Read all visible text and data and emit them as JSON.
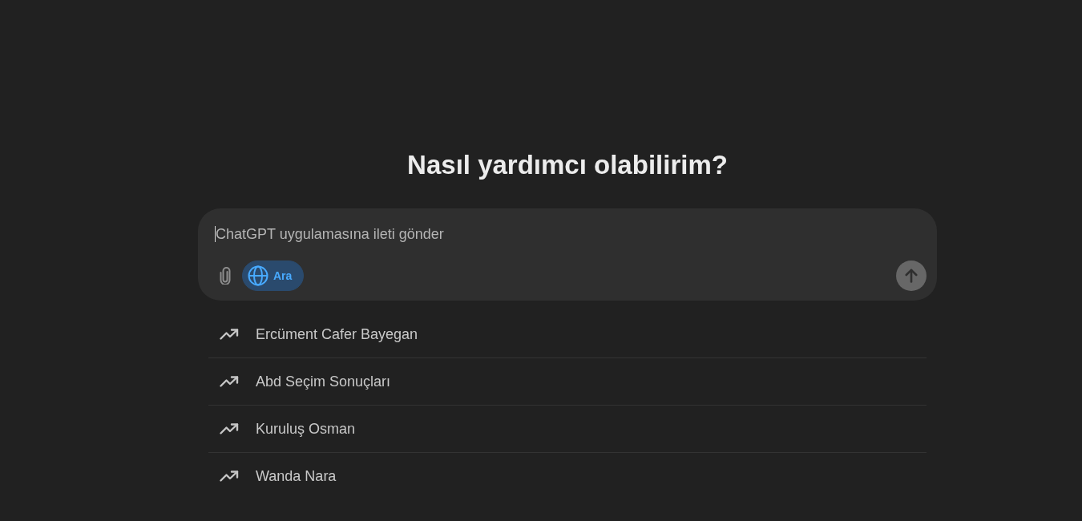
{
  "heading": "Nasıl yardımcı olabilirim?",
  "composer": {
    "placeholder": "ChatGPT uygulamasına ileti gönder",
    "focused": true,
    "search_toggle": {
      "label": "Ara",
      "selected": true
    },
    "send_button": {
      "disabled": true
    }
  },
  "suggestions": [
    {
      "label": "Ercüment Cafer Bayegan"
    },
    {
      "label": "Abd Seçim Sonuçları"
    },
    {
      "label": "Kuruluş Osman"
    },
    {
      "label": "Wanda Nara"
    }
  ]
}
